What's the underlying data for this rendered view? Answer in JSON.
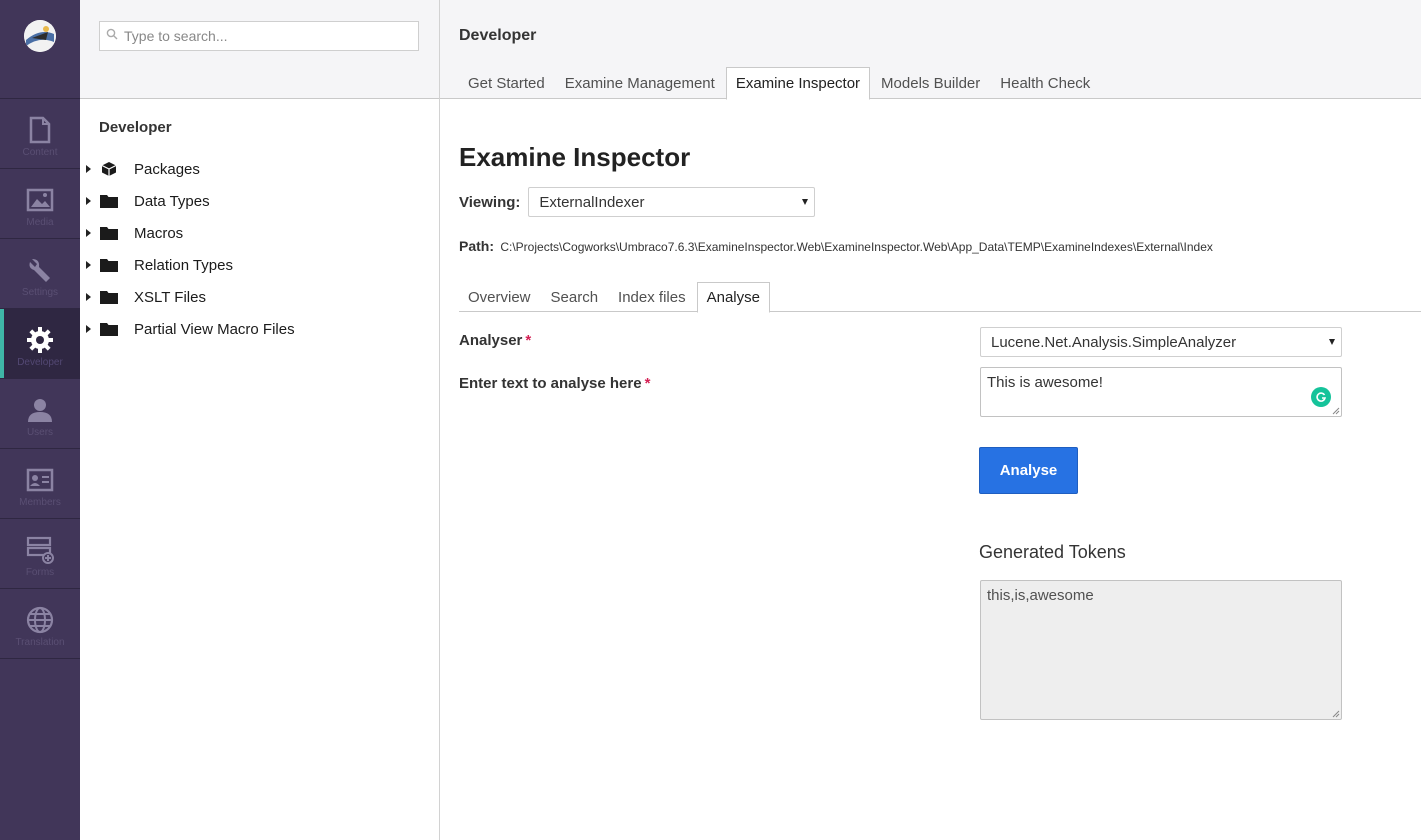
{
  "sections": [
    {
      "label": "Content",
      "icon": "document-icon"
    },
    {
      "label": "Media",
      "icon": "image-icon"
    },
    {
      "label": "Settings",
      "icon": "wrench-icon"
    },
    {
      "label": "Developer",
      "icon": "gear-icon",
      "active": true
    },
    {
      "label": "Users",
      "icon": "user-icon"
    },
    {
      "label": "Members",
      "icon": "id-card-icon"
    },
    {
      "label": "Forms",
      "icon": "form-icon"
    },
    {
      "label": "Translation",
      "icon": "globe-icon"
    }
  ],
  "search": {
    "placeholder": "Type to search..."
  },
  "tree": {
    "root": "Developer",
    "items": [
      {
        "label": "Packages",
        "icon": "package-icon"
      },
      {
        "label": "Data Types",
        "icon": "folder-icon"
      },
      {
        "label": "Macros",
        "icon": "folder-icon"
      },
      {
        "label": "Relation Types",
        "icon": "folder-icon"
      },
      {
        "label": "XSLT Files",
        "icon": "folder-icon"
      },
      {
        "label": "Partial View Macro Files",
        "icon": "folder-icon"
      }
    ]
  },
  "header": {
    "title": "Developer",
    "tabs": [
      "Get Started",
      "Examine Management",
      "Examine Inspector",
      "Models Builder",
      "Health Check"
    ],
    "active_tab": "Examine Inspector"
  },
  "inspector": {
    "title": "Examine Inspector",
    "viewing_label": "Viewing:",
    "viewing_value": "ExternalIndexer",
    "path_label": "Path:",
    "path_value": "C:\\Projects\\Cogworks\\Umbraco7.6.3\\ExamineInspector.Web\\ExamineInspector.Web\\App_Data\\TEMP\\ExamineIndexes\\External\\Index",
    "tabs": [
      "Overview",
      "Search",
      "Index files",
      "Analyse"
    ],
    "active_tab": "Analyse"
  },
  "analyse": {
    "analyser_label": "Analyser",
    "analyser_value": "Lucene.Net.Analysis.SimpleAnalyzer",
    "text_label": "Enter text to analyse here",
    "text_value": "This is awesome!",
    "required_mark": "*",
    "button_label": "Analyse",
    "tokens_title": "Generated Tokens",
    "tokens_value": "this,is,awesome"
  },
  "colors": {
    "sidebar": "#413659",
    "active_accent": "#3fb6a7",
    "primary_button": "#2772e3",
    "required": "#d42054"
  }
}
